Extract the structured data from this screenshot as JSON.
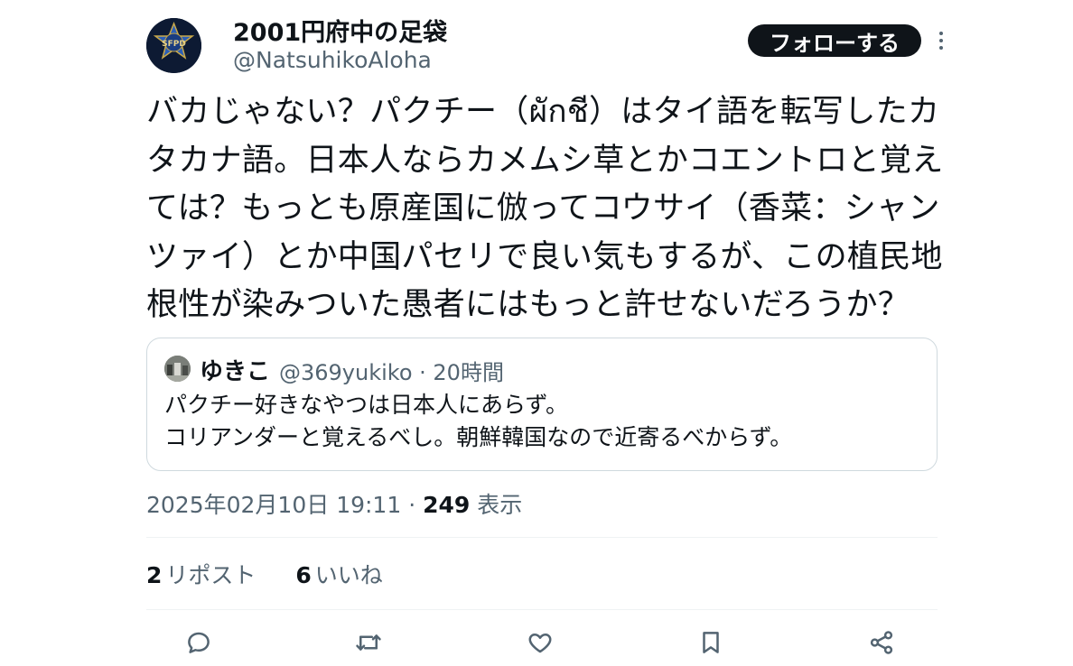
{
  "author": {
    "display_name": "2001円府中の足袋",
    "handle": "@NatsuhikoAloha",
    "avatar_text": "SFPD"
  },
  "follow_label": "フォローする",
  "tweet_lines": [
    "バカじゃない？パクチー（ผักชี）はタイ語を転写したカ",
    "タカナ語。日本人ならカメムシ草とかコエントロと覚え",
    "ては？もっとも原産国に倣ってコウサイ（香菜：シャン",
    "ツァイ）とか中国パセリで良い気もするが、この植民地",
    "根性が染みついた愚者にはもっと許せないだろうか？"
  ],
  "quote": {
    "name": "ゆきこ",
    "meta": "@369yukiko · 20時間",
    "lines": [
      "パクチー好きなやつは日本人にあらず。",
      "コリアンダーと覚えるべし。朝鮮韓国なので近寄るべからず。"
    ]
  },
  "meta": {
    "timestamp": "2025年02月10日 19:11",
    "separator": " · ",
    "views_count": "249",
    "views_label": " 表示"
  },
  "stats": {
    "reposts_count": "2",
    "reposts_label": "リポスト",
    "likes_count": "6",
    "likes_label": "いいね"
  },
  "actions": [
    "reply-icon",
    "repost-icon",
    "like-icon",
    "bookmark-icon",
    "share-icon"
  ],
  "colors": {
    "text": "#0f1419",
    "secondary": "#536471",
    "border": "#cfd9de",
    "divider": "#eff3f4",
    "follow_bg": "#0f1419"
  }
}
